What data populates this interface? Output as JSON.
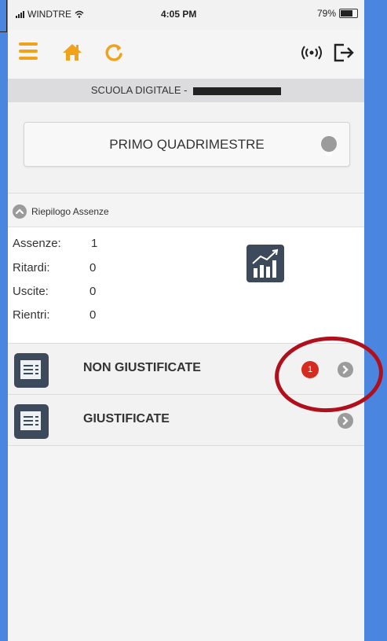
{
  "status_bar": {
    "carrier": "WINDTRE",
    "time": "4:05 PM",
    "battery": "79%"
  },
  "header": {
    "school_label": "SCUOLA DIGITALE -"
  },
  "period_selector": {
    "value": "PRIMO QUADRIMESTRE"
  },
  "summary": {
    "title": "Riepilogo Assenze",
    "rows": [
      {
        "label": "Assenze:",
        "value": "1"
      },
      {
        "label": "Ritardi:",
        "value": "0"
      },
      {
        "label": "Uscite:",
        "value": "0"
      },
      {
        "label": "Rientri:",
        "value": "0"
      }
    ]
  },
  "list": [
    {
      "label": "NON GIUSTIFICATE",
      "badge": "1"
    },
    {
      "label": "GIUSTIFICATE",
      "badge": ""
    }
  ],
  "colors": {
    "accent": "#f0a21a",
    "badge": "#d62b1f",
    "annotation": "#b0101b",
    "icon_bg": "#3d4a5c"
  },
  "icons": [
    "menu-icon",
    "home-icon",
    "refresh-icon",
    "broadcast-icon",
    "logout-icon",
    "chevron-down-icon",
    "collapse-icon",
    "chart-icon",
    "list-document-icon",
    "chevron-right-icon"
  ]
}
